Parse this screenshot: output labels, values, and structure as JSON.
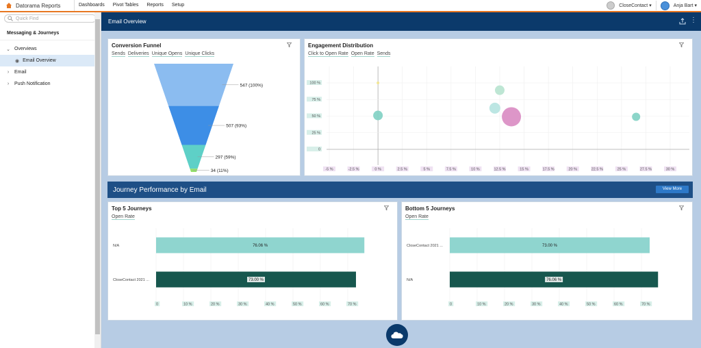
{
  "app": {
    "name": "Datorama Reports"
  },
  "nav": {
    "tabs": [
      "Dashboards",
      "Pivot Tables",
      "Reports",
      "Setup"
    ]
  },
  "account": {
    "workspace": "CloseContact",
    "user": "Anja Bart"
  },
  "sidebar": {
    "search_placeholder": "Quick Find",
    "title": "Messaging & Journeys",
    "items": [
      {
        "label": "Overviews"
      },
      {
        "label": "Email Overview"
      },
      {
        "label": "Email"
      },
      {
        "label": "Push Notification"
      }
    ]
  },
  "header": {
    "title": "Email Overview"
  },
  "funnel": {
    "title": "Conversion Funnel",
    "tabs": [
      "Sends",
      "Deliveries",
      "Unique Opens",
      "Unique Clicks"
    ],
    "colors": [
      "#8bbcf0",
      "#3d8ee6",
      "#5ed0c7",
      "#93e06a"
    ]
  },
  "engagement": {
    "title": "Engagement Distribution",
    "tabs": [
      "Click to Open Rate",
      "Open Rate",
      "Sends"
    ]
  },
  "banner": {
    "title": "Journey Performance by Email",
    "button": "View More"
  },
  "top5": {
    "title": "Top 5 Journeys",
    "tab": "Open Rate"
  },
  "bottom5": {
    "title": "Bottom 5 Journeys",
    "tab": "Open Rate"
  },
  "chart_data": [
    {
      "type": "funnel",
      "title": "Conversion Funnel",
      "categories": [
        "Sends",
        "Deliveries",
        "Unique Opens",
        "Unique Clicks"
      ],
      "values": [
        547,
        507,
        297,
        34
      ],
      "labels": [
        "547 (100%)",
        "507 (93%)",
        "297 (59%)",
        "34 (11%)"
      ]
    },
    {
      "type": "scatter",
      "title": "Engagement Distribution",
      "x_ticks": [
        "-5 %",
        "-2.5 %",
        "0 %",
        "2.5 %",
        "5 %",
        "7.5 %",
        "10 %",
        "12.5 %",
        "15 %",
        "17.5 %",
        "20 %",
        "22.5 %",
        "25 %",
        "27.5 %",
        "30 %"
      ],
      "y_ticks": [
        "100 %",
        "75 %",
        "50 %",
        "25 %",
        "0"
      ],
      "xlim": [
        -5,
        30
      ],
      "ylim": [
        0,
        100
      ],
      "points": [
        {
          "x": 0,
          "y": 100,
          "size": 2,
          "color": "#f3e58a"
        },
        {
          "x": 0,
          "y": 51,
          "size": 7,
          "color": "#7fd0c3"
        },
        {
          "x": 12.5,
          "y": 89,
          "size": 7,
          "color": "#b7e3cf"
        },
        {
          "x": 12,
          "y": 62,
          "size": 8,
          "color": "#b5e3e0"
        },
        {
          "x": 13.7,
          "y": 49,
          "size": 14,
          "color": "#d98bc2"
        },
        {
          "x": 26.5,
          "y": 49,
          "size": 6,
          "color": "#7fd0c3"
        }
      ]
    },
    {
      "type": "bar",
      "orientation": "horizontal",
      "title": "Top 5 Journeys",
      "categories": [
        "N/A",
        "CloseContact 2021 ..."
      ],
      "values": [
        76.06,
        73.0
      ],
      "value_labels": [
        "76.06 %",
        "73.00 %"
      ],
      "colors": [
        "#8fd5cf",
        "#17574e"
      ],
      "x_ticks": [
        "0",
        "10 %",
        "20 %",
        "30 %",
        "40 %",
        "50 %",
        "60 %",
        "70 %"
      ],
      "xlim": [
        0,
        80
      ]
    },
    {
      "type": "bar",
      "orientation": "horizontal",
      "title": "Bottom 5 Journeys",
      "categories": [
        "CloseContact 2021 ...",
        "N/A"
      ],
      "values": [
        73.0,
        76.06
      ],
      "value_labels": [
        "73.00 %",
        "76.06 %"
      ],
      "colors": [
        "#8fd5cf",
        "#17574e"
      ],
      "x_ticks": [
        "0",
        "10 %",
        "20 %",
        "30 %",
        "40 %",
        "50 %",
        "60 %",
        "70 %"
      ],
      "xlim": [
        0,
        80
      ]
    }
  ]
}
